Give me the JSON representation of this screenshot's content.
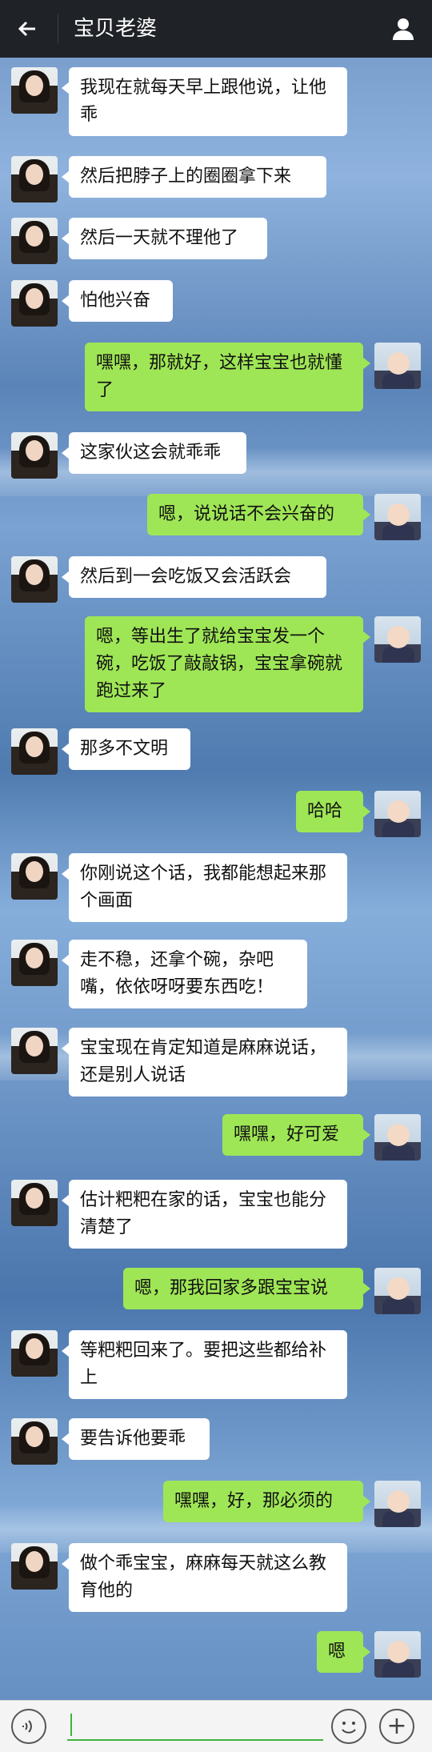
{
  "header": {
    "title": "宝贝老婆",
    "back_icon": "back-arrow-icon",
    "profile_icon": "person-icon"
  },
  "messages": [
    {
      "side": "in",
      "text": "我现在就每天早上跟他说，让他乖"
    },
    {
      "side": "in",
      "text": "然后把脖子上的圈圈拿下来"
    },
    {
      "side": "in",
      "text": "然后一天就不理他了"
    },
    {
      "side": "in",
      "text": "怕他兴奋"
    },
    {
      "side": "out",
      "text": "嘿嘿，那就好，这样宝宝也就懂了"
    },
    {
      "side": "in",
      "text": "这家伙这会就乖乖"
    },
    {
      "side": "out",
      "text": "嗯，说说话不会兴奋的"
    },
    {
      "side": "in",
      "text": "然后到一会吃饭又会活跃会"
    },
    {
      "side": "out",
      "text": "嗯，等出生了就给宝宝发一个碗，吃饭了敲敲锅，宝宝拿碗就跑过来了"
    },
    {
      "side": "in",
      "text": "那多不文明"
    },
    {
      "side": "out",
      "text": "哈哈"
    },
    {
      "side": "in",
      "text": "你刚说这个话，我都能想起来那个画面"
    },
    {
      "side": "in",
      "text": "走不稳，还拿个碗，杂吧嘴，依依呀呀要东西吃！"
    },
    {
      "side": "in",
      "text": "宝宝现在肯定知道是麻麻说话，还是别人说话"
    },
    {
      "side": "out",
      "text": "嘿嘿，好可爱"
    },
    {
      "side": "in",
      "text": "估计粑粑在家的话，宝宝也能分清楚了"
    },
    {
      "side": "out",
      "text": "嗯，那我回家多跟宝宝说"
    },
    {
      "side": "in",
      "text": "等粑粑回来了。要把这些都给补上"
    },
    {
      "side": "in",
      "text": "要告诉他要乖"
    },
    {
      "side": "out",
      "text": "嘿嘿，好，那必须的"
    },
    {
      "side": "in",
      "text": "做个乖宝宝，麻麻每天就这么教育他的"
    },
    {
      "side": "out",
      "text": "嗯"
    }
  ],
  "input_bar": {
    "voice_icon": "voice-icon",
    "emoji_icon": "emoji-icon",
    "plus_icon": "plus-icon",
    "plus_glyph": "+",
    "input_value": ""
  }
}
